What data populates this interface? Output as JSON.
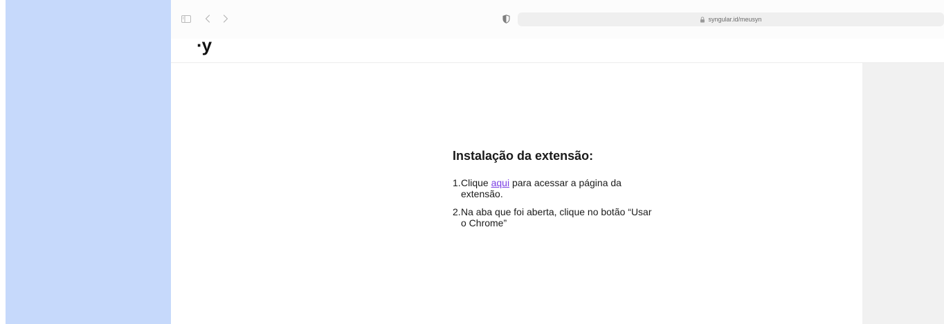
{
  "colors": {
    "left_panel": "#c6d9fb",
    "link": "#7b3fe4",
    "right_rail": "#f1f1f1"
  },
  "browser": {
    "url": "syngular.id/meusyn",
    "icons": {
      "sidebar": "sidebar-toggle-icon",
      "back": "chevron-left-icon",
      "forward": "chevron-right-icon",
      "privacy": "shield-icon",
      "lock": "lock-icon"
    }
  },
  "site": {
    "logo": "·y"
  },
  "install": {
    "title": "Instalação da extensão:",
    "steps": [
      {
        "number": "1.",
        "before_link": " Clique ",
        "link": "aqui",
        "after_link": " para acessar a página da extensão."
      },
      {
        "number": "2.",
        "text": " Na aba que foi aberta, clique no botão “Usar o Chrome”"
      }
    ]
  }
}
